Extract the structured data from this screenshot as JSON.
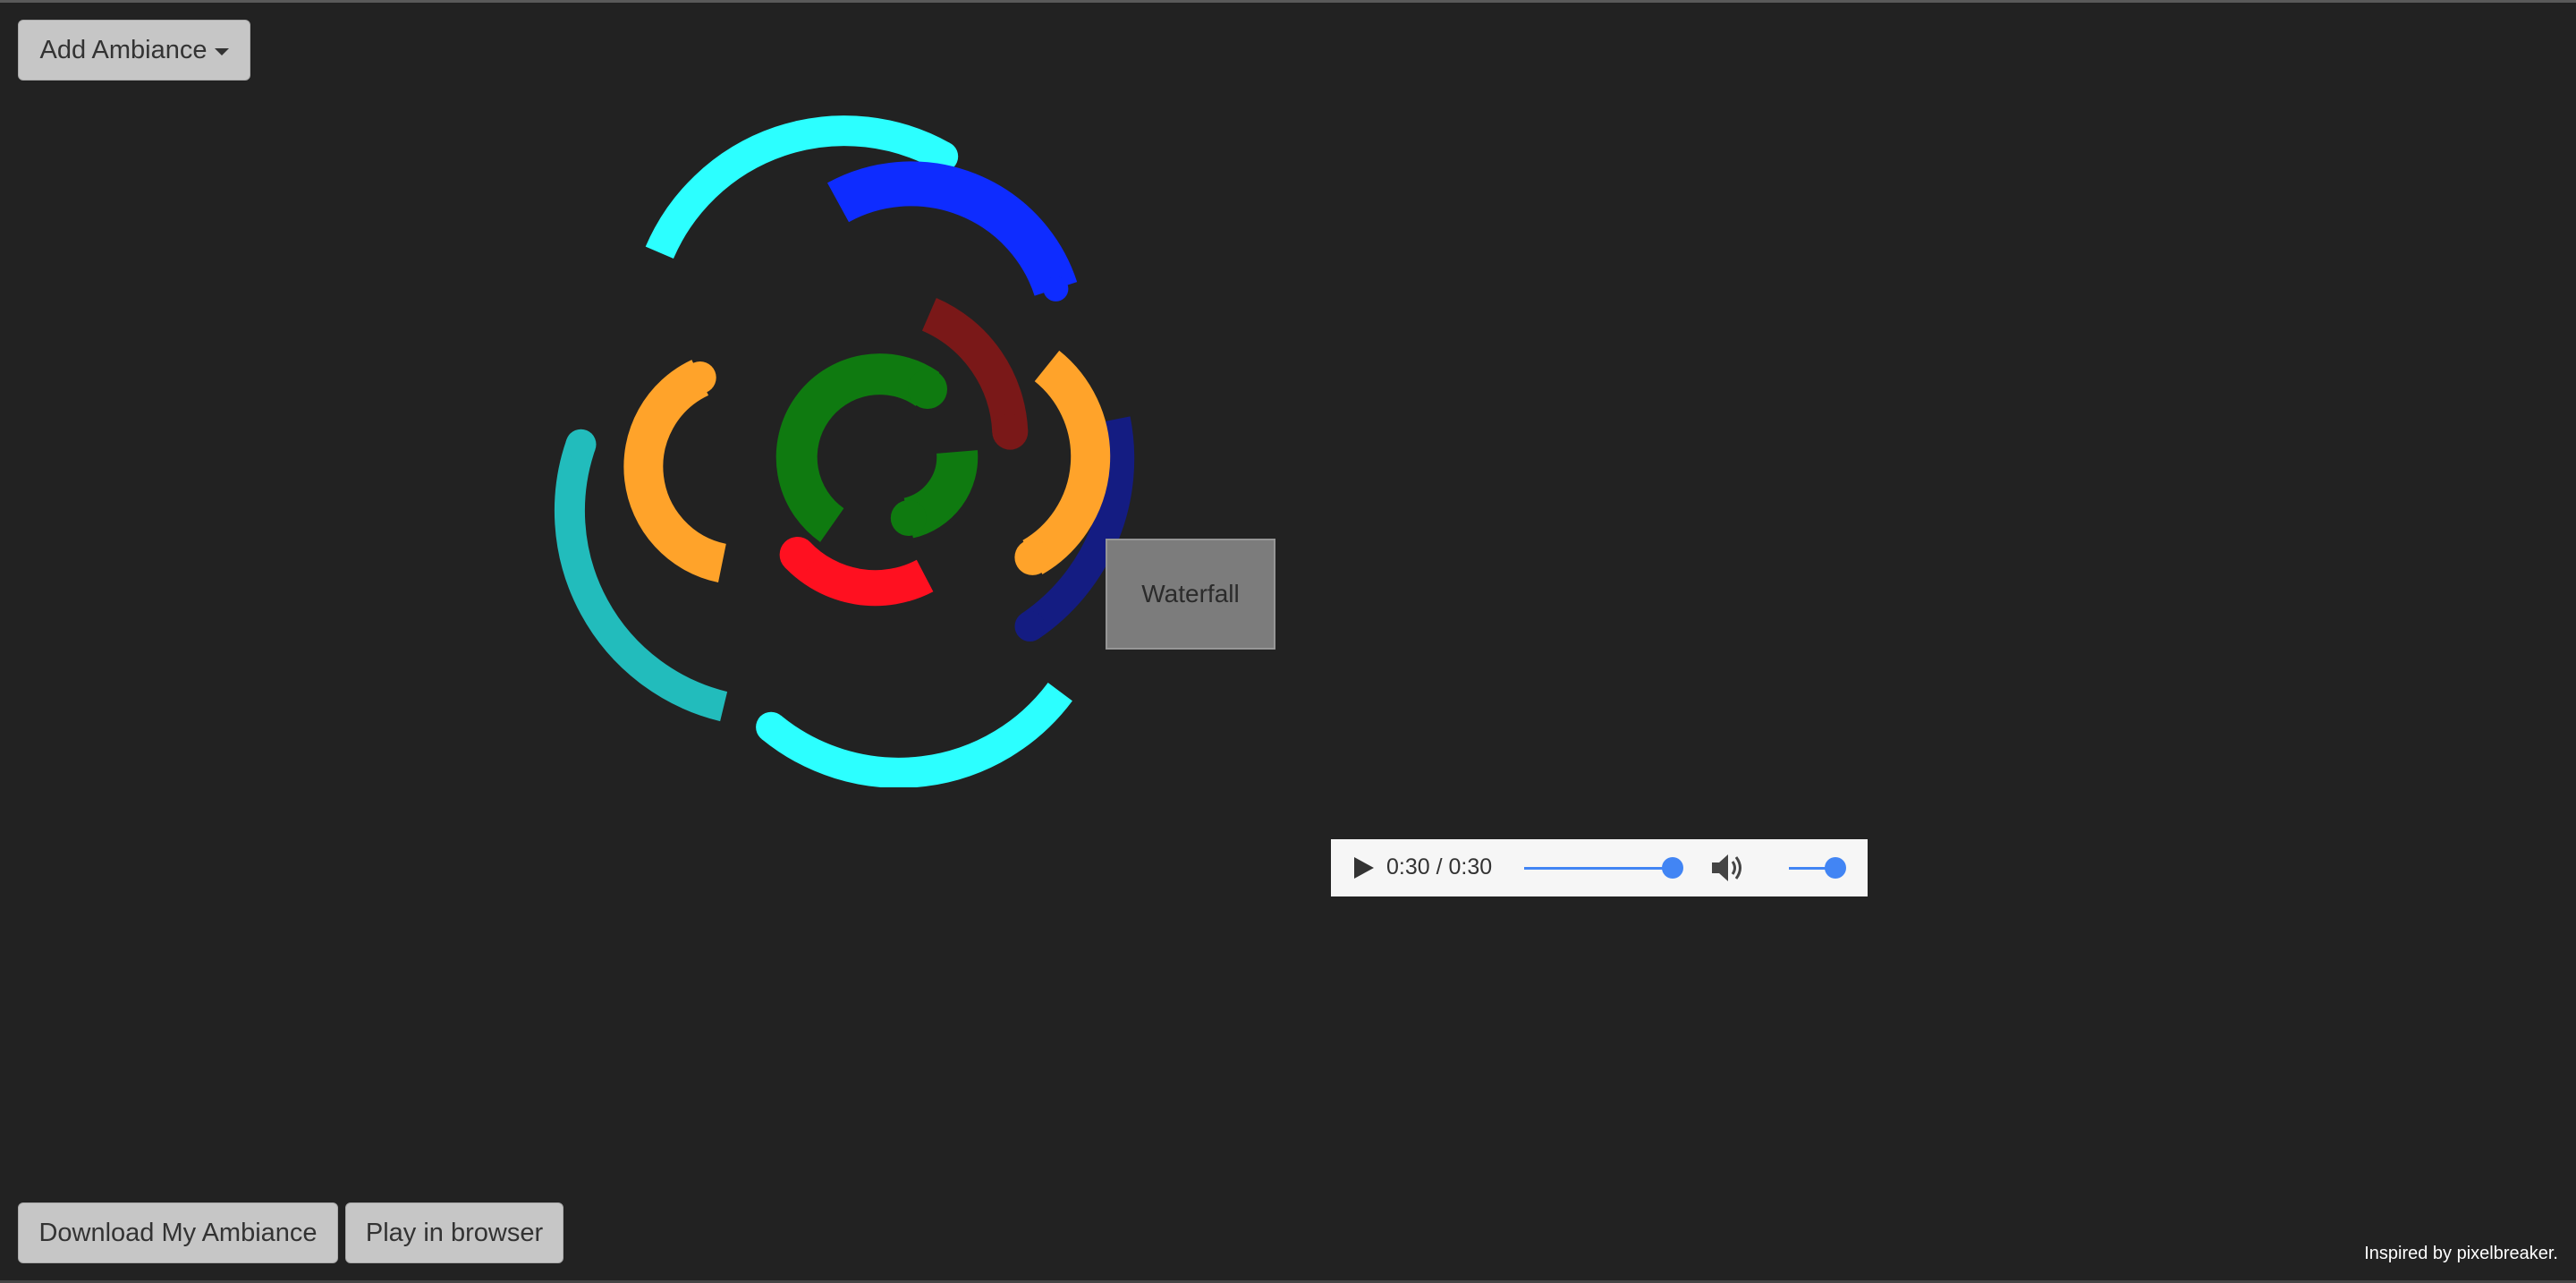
{
  "toolbar": {
    "add_ambiance_label": "Add Ambiance"
  },
  "footer": {
    "download_label": "Download My Ambiance",
    "play_label": "Play in browser",
    "credit": "Inspired by pixelbreaker."
  },
  "tooltip": {
    "label": "Waterfall"
  },
  "audio_player": {
    "time_display": "0:30 / 0:30",
    "progress": 1.0,
    "volume": 1.0,
    "accent_color": "#4285f4"
  },
  "visualizer": {
    "arcs": [
      {
        "name": "cyan-outer-top",
        "color": "#2cffff"
      },
      {
        "name": "cyan-outer-bottom",
        "color": "#2cffff"
      },
      {
        "name": "teal-outer-left",
        "color": "#22bcbc"
      },
      {
        "name": "blue-upper-right",
        "color": "#0e2cff"
      },
      {
        "name": "navy-right",
        "color": "#141c82"
      },
      {
        "name": "orange-left",
        "color": "#ffa32a"
      },
      {
        "name": "orange-right",
        "color": "#ffa32a"
      },
      {
        "name": "red-bottom",
        "color": "#ff1020"
      },
      {
        "name": "darkred-upper-right",
        "color": "#7a1818"
      },
      {
        "name": "green-inner-left",
        "color": "#0f7a10"
      },
      {
        "name": "green-inner-right",
        "color": "#0f7a10"
      }
    ]
  }
}
